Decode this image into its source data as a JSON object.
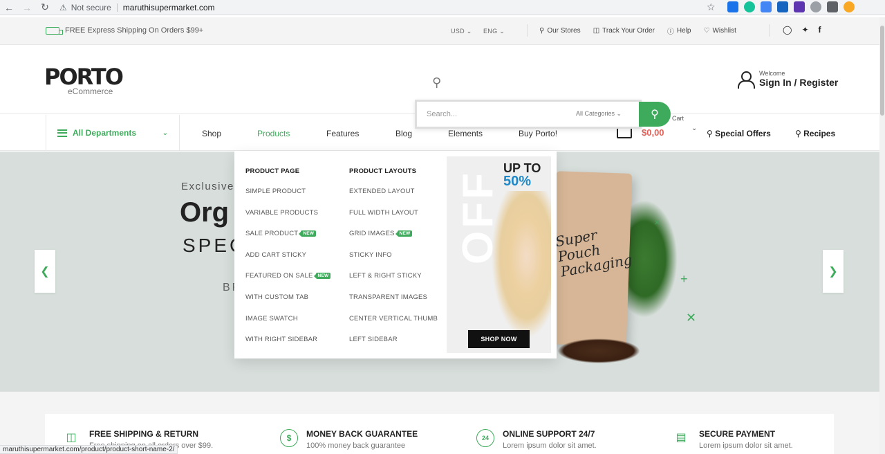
{
  "browser": {
    "security_label": "Not secure",
    "url": "maruthisupermarket.com",
    "status_url": "maruthisupermarket.com/product/product-short-name-2/"
  },
  "topbar": {
    "shipping": "FREE Express Shipping On Orders $99+",
    "currency": "USD",
    "language": "ENG",
    "links": [
      "Our Stores",
      "Track Your Order",
      "Help",
      "Wishlist"
    ]
  },
  "header": {
    "logo_main": "PORTO",
    "logo_sub": "eCommerce",
    "welcome": "Welcome",
    "signin": "Sign In / Register"
  },
  "search": {
    "placeholder": "Search...",
    "category": "All Categories"
  },
  "nav": {
    "departments": "All Departments",
    "items": [
      "Shop",
      "Products",
      "Features",
      "Blog",
      "Elements",
      "Buy Porto!"
    ],
    "active": "Products",
    "cart_label": "Cart",
    "cart_amount": "$0,00",
    "special_offers": "Special Offers",
    "recipes": "Recipes"
  },
  "hero": {
    "line1": "Exclusive",
    "line2": "Org",
    "line3": "SPEC",
    "line4": "BR",
    "product_brand": "Super Pouch Packaging"
  },
  "mega_menu": {
    "col1_title": "PRODUCT PAGE",
    "col1_items": [
      {
        "label": "SIMPLE PRODUCT",
        "badge": ""
      },
      {
        "label": "VARIABLE PRODUCTS",
        "badge": ""
      },
      {
        "label": "SALE PRODUCT",
        "badge": "NEW"
      },
      {
        "label": "ADD CART STICKY",
        "badge": ""
      },
      {
        "label": "FEATURED ON SALE",
        "badge": "NEW"
      },
      {
        "label": "WITH CUSTOM TAB",
        "badge": ""
      },
      {
        "label": "IMAGE SWATCH",
        "badge": ""
      },
      {
        "label": "WITH RIGHT SIDEBAR",
        "badge": ""
      }
    ],
    "col2_title": "PRODUCT LAYOUTS",
    "col2_items": [
      {
        "label": "EXTENDED LAYOUT",
        "badge": ""
      },
      {
        "label": "FULL WIDTH LAYOUT",
        "badge": ""
      },
      {
        "label": "GRID IMAGES",
        "badge": "NEW"
      },
      {
        "label": "STICKY INFO",
        "badge": ""
      },
      {
        "label": "LEFT & RIGHT STICKY",
        "badge": ""
      },
      {
        "label": "TRANSPARENT IMAGES",
        "badge": ""
      },
      {
        "label": "CENTER VERTICAL THUMB",
        "badge": ""
      },
      {
        "label": "LEFT SIDEBAR",
        "badge": ""
      }
    ],
    "promo_off": "OFF",
    "promo_upto": "UP TO",
    "promo_pct": "50%",
    "promo_button": "SHOP NOW"
  },
  "features": [
    {
      "title": "FREE SHIPPING & RETURN",
      "desc": "Free shipping on all orders over $99.",
      "icon": "truck-icon"
    },
    {
      "title": "MONEY BACK GUARANTEE",
      "desc": "100% money back guarantee",
      "icon": "dollar-icon"
    },
    {
      "title": "ONLINE SUPPORT 24/7",
      "desc": "Lorem ipsum dolor sit amet.",
      "icon": "support-24-icon"
    },
    {
      "title": "SECURE PAYMENT",
      "desc": "Lorem ipsum dolor sit amet.",
      "icon": "card-icon"
    }
  ],
  "colors": {
    "accent_green": "#3eab5c",
    "price_red": "#e36159",
    "promo_blue": "#1e88c8"
  }
}
